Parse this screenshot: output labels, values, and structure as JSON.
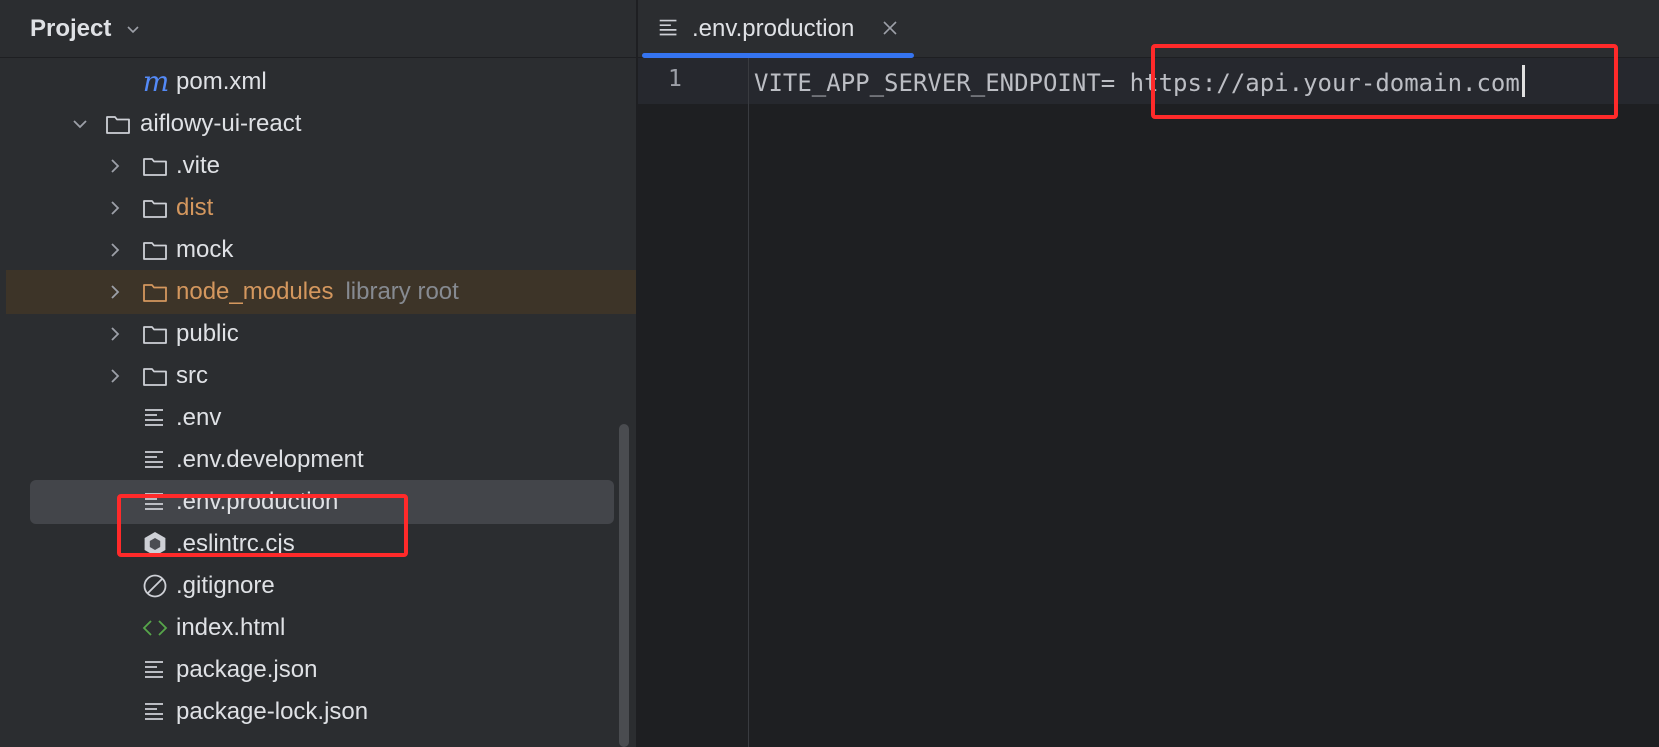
{
  "project_panel": {
    "title": "Project",
    "items": [
      {
        "label": "pom.xml",
        "icon": "maven-icon",
        "expandable": false
      },
      {
        "label": "aiflowy-ui-react",
        "icon": "folder-icon",
        "expandable": true,
        "expanded": true
      },
      {
        "label": ".vite",
        "icon": "folder-icon",
        "expandable": true
      },
      {
        "label": "dist",
        "icon": "folder-icon",
        "expandable": true,
        "color": "#d4975e"
      },
      {
        "label": "mock",
        "icon": "folder-icon",
        "expandable": true
      },
      {
        "label": "node_modules",
        "hint": "library root",
        "icon": "folder-icon",
        "expandable": true,
        "color": "#d4975e"
      },
      {
        "label": "public",
        "icon": "folder-icon",
        "expandable": true
      },
      {
        "label": "src",
        "icon": "folder-icon",
        "expandable": true
      },
      {
        "label": ".env",
        "icon": "text-file-icon"
      },
      {
        "label": ".env.development",
        "icon": "text-file-icon"
      },
      {
        "label": ".env.production",
        "icon": "text-file-icon",
        "selected": true
      },
      {
        "label": ".eslintrc.cjs",
        "icon": "eslint-icon"
      },
      {
        "label": ".gitignore",
        "icon": "ignore-file-icon"
      },
      {
        "label": "index.html",
        "icon": "html-file-icon"
      },
      {
        "label": "package.json",
        "icon": "text-file-icon"
      },
      {
        "label": "package-lock.json",
        "icon": "text-file-icon"
      }
    ]
  },
  "editor": {
    "tab": {
      "label": ".env.production"
    },
    "lines": [
      {
        "number": "1",
        "key": "VITE_APP_SERVER_ENDPOINT=",
        "value": " https://api.your-domain.com"
      }
    ]
  },
  "colors": {
    "accent": "#3574f0",
    "annotation": "#ff2a2a",
    "excluded_folder": "#d4975e"
  }
}
